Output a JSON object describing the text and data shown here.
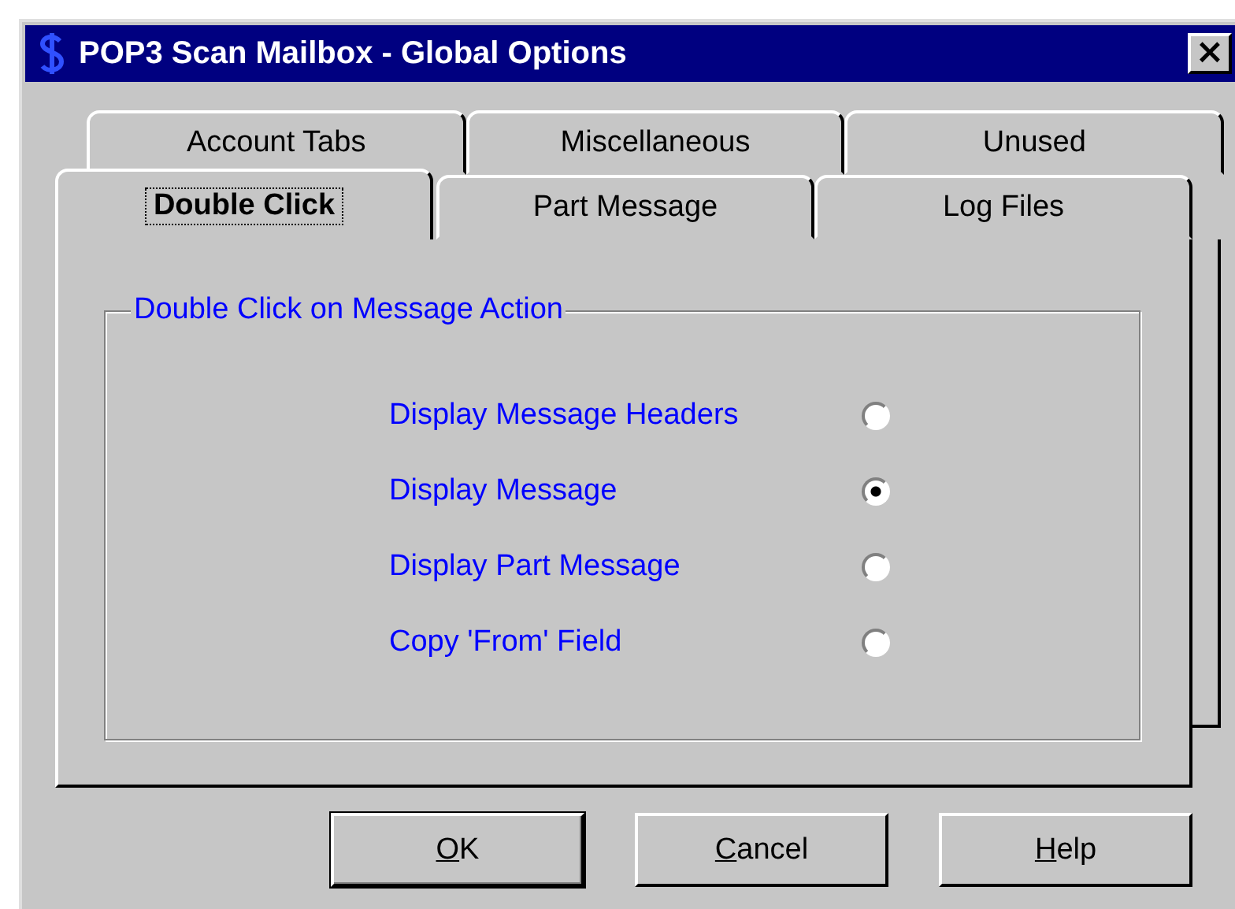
{
  "window": {
    "title": "POP3 Scan Mailbox - Global Options",
    "close": "×"
  },
  "tab_rows": [
    {
      "tabs": [
        {
          "label": "Account Tabs",
          "selected": false
        },
        {
          "label": "Miscellaneous",
          "selected": false
        },
        {
          "label": "Unused",
          "selected": false
        }
      ]
    },
    {
      "tabs": [
        {
          "label": "Double Click",
          "selected": true,
          "focused": true
        },
        {
          "label": "Part Message",
          "selected": false,
          "focused": false
        },
        {
          "label": "Log Files",
          "selected": false,
          "focused": false
        }
      ]
    }
  ],
  "group": {
    "title": "Double Click on Message Action",
    "options": [
      {
        "label": "Display Message Headers",
        "selected": false
      },
      {
        "label": "Display Message",
        "selected": true
      },
      {
        "label": "Display Part Message",
        "selected": false
      },
      {
        "label": "Copy 'From' Field",
        "selected": false
      }
    ]
  },
  "buttons": [
    {
      "label": "OK",
      "underline_first": true,
      "default": true
    },
    {
      "label": "Cancel",
      "underline_first": true,
      "default": false
    },
    {
      "label": "Help",
      "underline_first": true,
      "default": false
    }
  ]
}
